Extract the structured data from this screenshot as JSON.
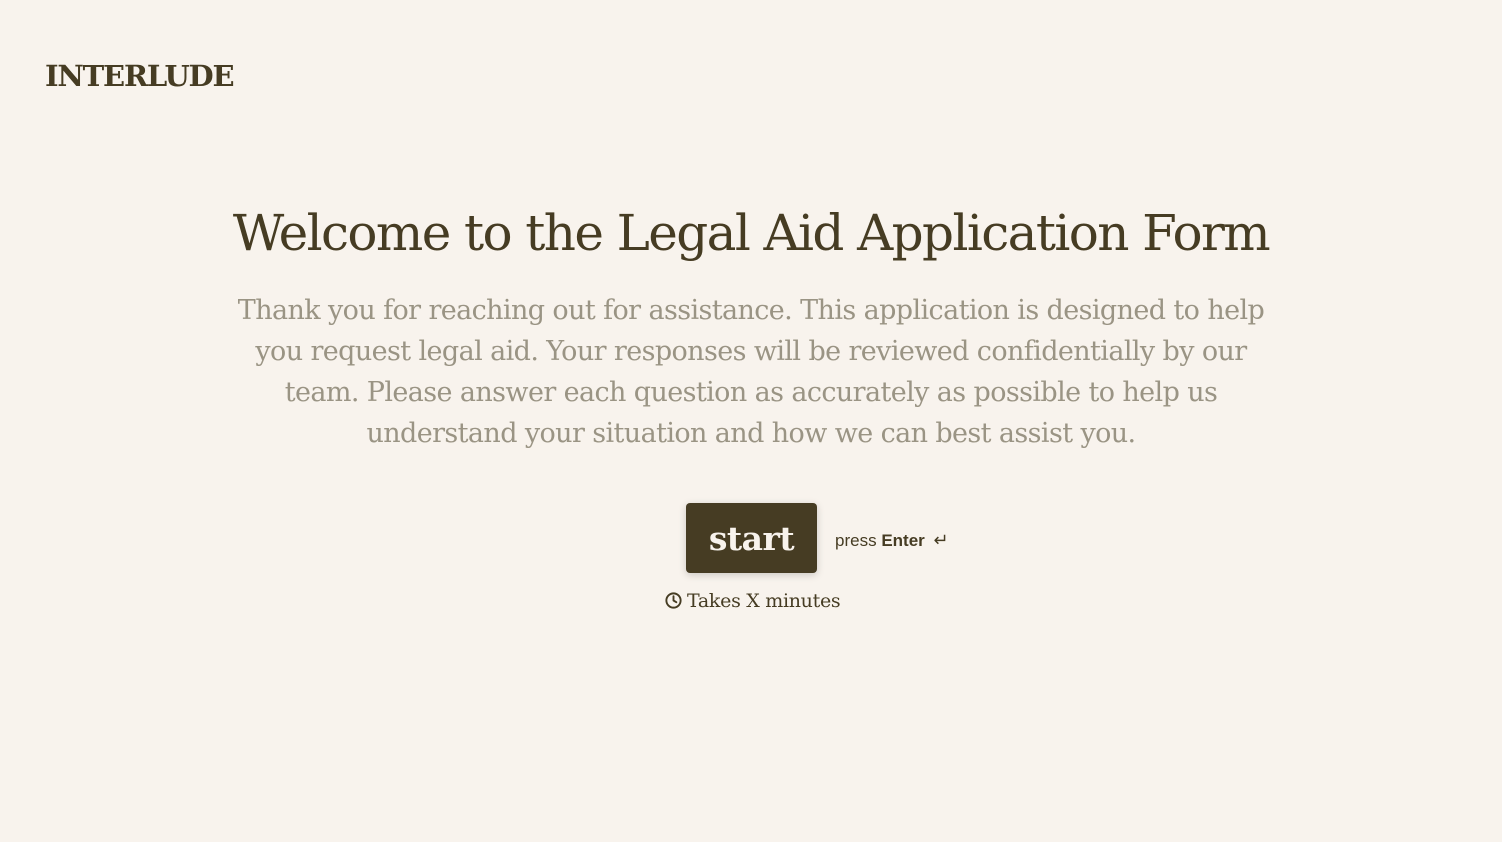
{
  "header": {
    "logo_text": "INTERLUDE"
  },
  "welcome": {
    "title": "Welcome to the Legal Aid Application Form",
    "description": "Thank you for reaching out for assistance. This application is designed to help you request legal aid. Your responses will be reviewed confidentially by our team. Please answer each question as accurately as possible to help us understand your situation and how we can best assist you.",
    "start_label": "start",
    "hint_prefix": "press",
    "hint_key": "Enter",
    "hint_icon": "↵",
    "duration_text": "Takes X minutes",
    "duration_icon": "clock-icon"
  },
  "colors": {
    "background": "#f8f3ed",
    "primary": "#463c23",
    "muted_text": "#9a9484"
  }
}
